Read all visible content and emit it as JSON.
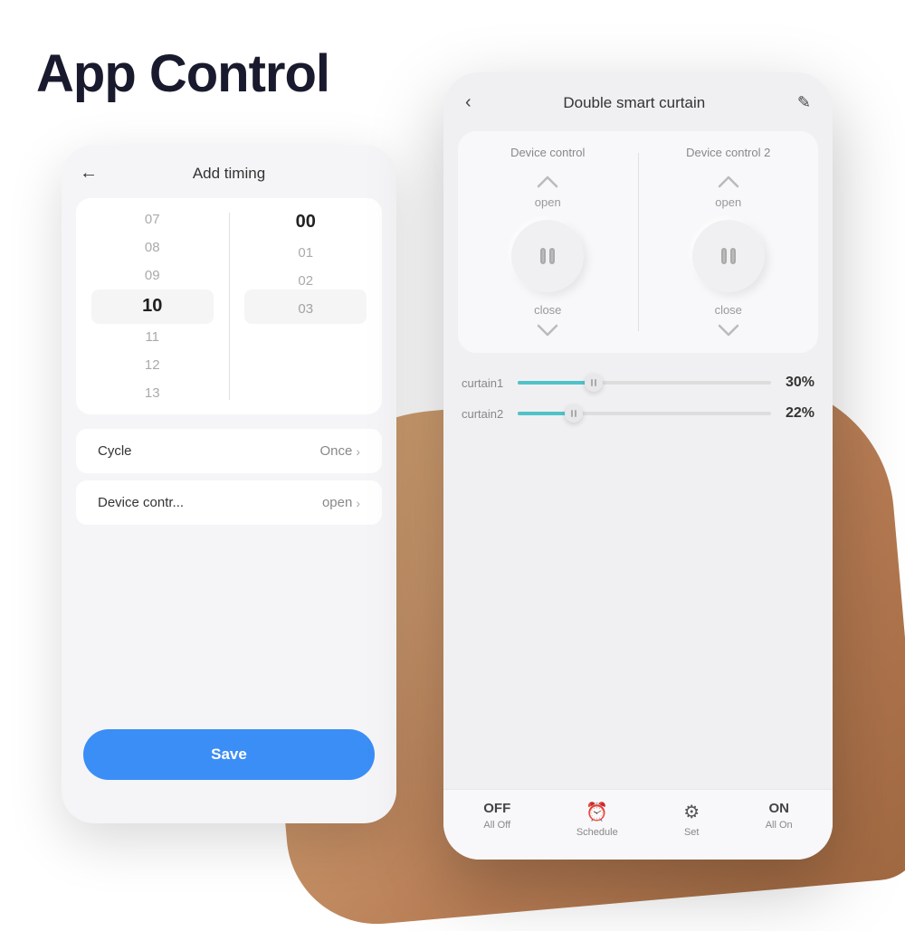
{
  "page": {
    "title": "App Control",
    "background": "#ffffff"
  },
  "phone1": {
    "header": {
      "back_icon": "←",
      "title": "Add timing"
    },
    "time_picker": {
      "hours": [
        "07",
        "08",
        "09",
        "10",
        "11",
        "12",
        "13"
      ],
      "minutes": [
        "00",
        "01",
        "02",
        "03"
      ],
      "selected_hour": "10",
      "selected_minute": "00"
    },
    "settings": [
      {
        "label": "Cycle",
        "value": "Once"
      },
      {
        "label": "Device contr...",
        "value": "open"
      }
    ],
    "save_button": "Save"
  },
  "phone2": {
    "header": {
      "back_icon": "‹",
      "title": "Double smart curtain",
      "edit_icon": "✎"
    },
    "device_controls": [
      {
        "header": "Device control",
        "open_label": "open",
        "close_label": "close"
      },
      {
        "header": "Device control 2",
        "open_label": "open",
        "close_label": "close"
      }
    ],
    "sliders": [
      {
        "label": "curtain1",
        "percent": 30,
        "fill_pct": "30%"
      },
      {
        "label": "curtain2",
        "percent": 22,
        "fill_pct": "22%"
      }
    ],
    "bottom_bar": [
      {
        "key": "off",
        "icon": "OFF",
        "label": "All Off"
      },
      {
        "key": "schedule",
        "icon": "⏰",
        "label": "Schedule"
      },
      {
        "key": "set",
        "icon": "⚙",
        "label": "Set"
      },
      {
        "key": "on",
        "icon": "ON",
        "label": "All On"
      }
    ]
  }
}
